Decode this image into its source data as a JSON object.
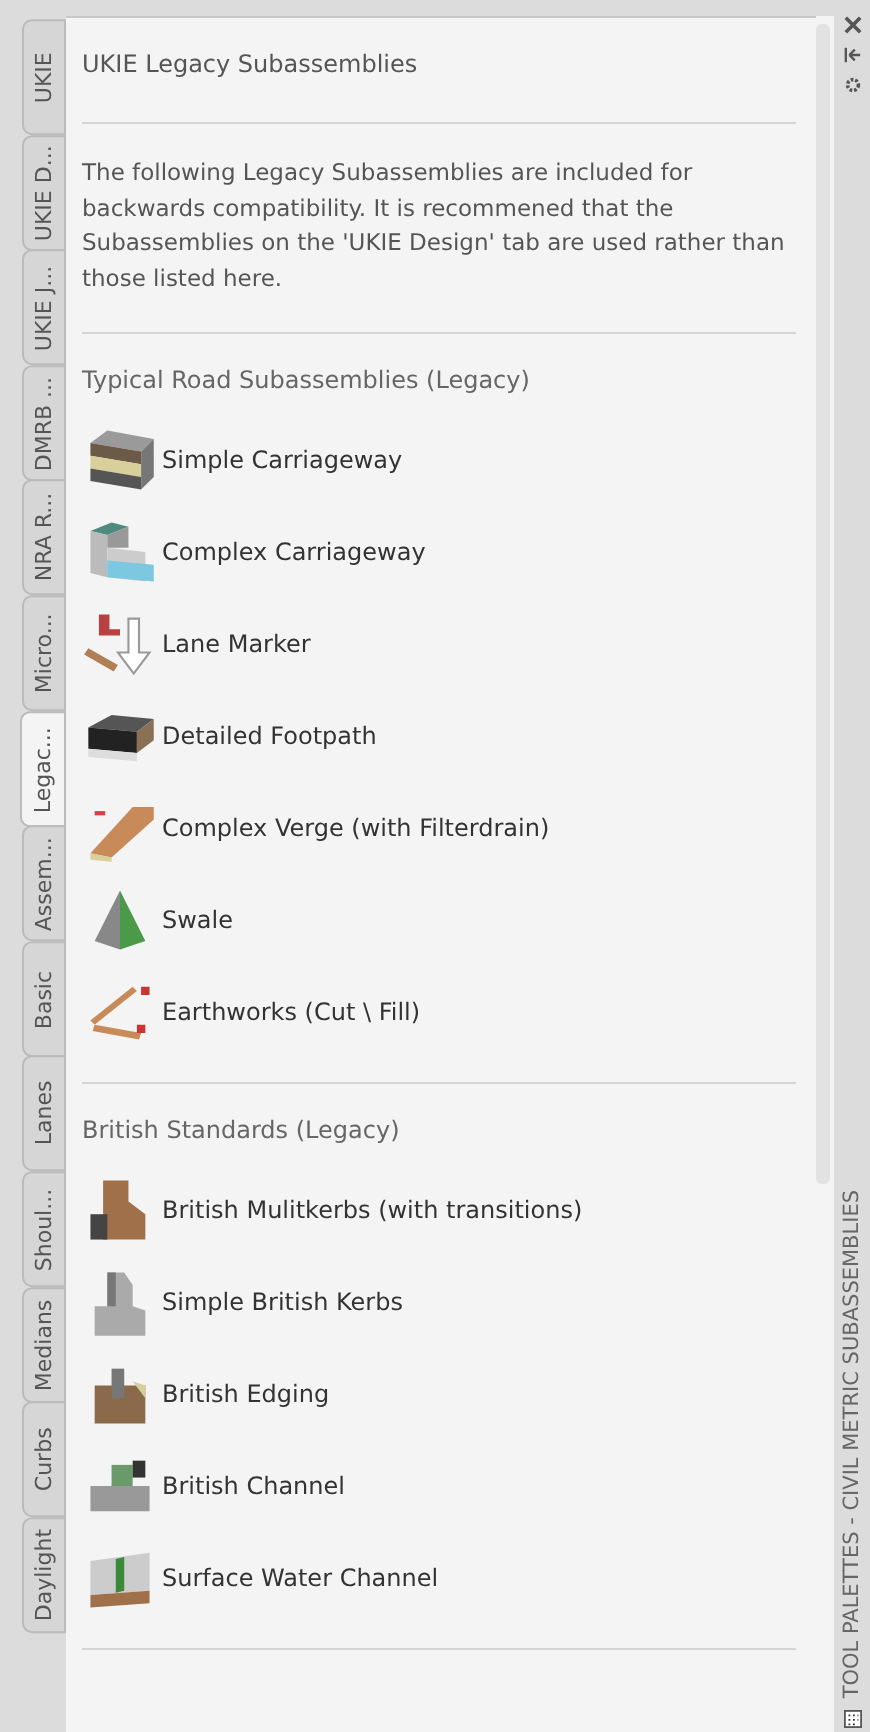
{
  "tabs": [
    {
      "label": "UKIE",
      "selected": false
    },
    {
      "label": "UKIE D...",
      "selected": false
    },
    {
      "label": "UKIE J...",
      "selected": false
    },
    {
      "label": "DMRB ...",
      "selected": false
    },
    {
      "label": "NRA R...",
      "selected": false
    },
    {
      "label": "Micro...",
      "selected": false
    },
    {
      "label": "Legac...",
      "selected": true
    },
    {
      "label": "Assem...",
      "selected": false
    },
    {
      "label": "Basic",
      "selected": false
    },
    {
      "label": "Lanes",
      "selected": false
    },
    {
      "label": "Shoul...",
      "selected": false
    },
    {
      "label": "Medians",
      "selected": false
    },
    {
      "label": "Curbs",
      "selected": false
    },
    {
      "label": "Daylight",
      "selected": false
    }
  ],
  "palette": {
    "title": "UKIE Legacy Subassemblies",
    "description": "The following Legacy Subassemblies are included for backwards compatibility. It is recommened that the Subassemblies on the 'UKIE Design' tab are used rather than those listed here.",
    "sections": [
      {
        "heading": "Typical Road Subassemblies (Legacy)",
        "tools": [
          {
            "label": "Simple Carriageway",
            "kind": "layers"
          },
          {
            "label": "Complex Carriageway",
            "kind": "steps"
          },
          {
            "label": "Lane Marker",
            "kind": "marker"
          },
          {
            "label": "Detailed Footpath",
            "kind": "slab"
          },
          {
            "label": "Complex Verge (with Filterdrain)",
            "kind": "verge"
          },
          {
            "label": "Swale",
            "kind": "swale"
          },
          {
            "label": "Earthworks (Cut \\ Fill)",
            "kind": "earthworks"
          }
        ]
      },
      {
        "heading": "British Standards (Legacy)",
        "tools": [
          {
            "label": "British Mulitkerbs (with transitions)",
            "kind": "multikerb"
          },
          {
            "label": "Simple British Kerbs",
            "kind": "kerb"
          },
          {
            "label": "British Edging",
            "kind": "edging"
          },
          {
            "label": "British Channel",
            "kind": "channel"
          },
          {
            "label": "Surface Water Channel",
            "kind": "surface"
          }
        ]
      }
    ]
  },
  "side_bar": {
    "title": "TOOL PALETTES - CIVIL METRIC SUBASSEMBLIES"
  }
}
